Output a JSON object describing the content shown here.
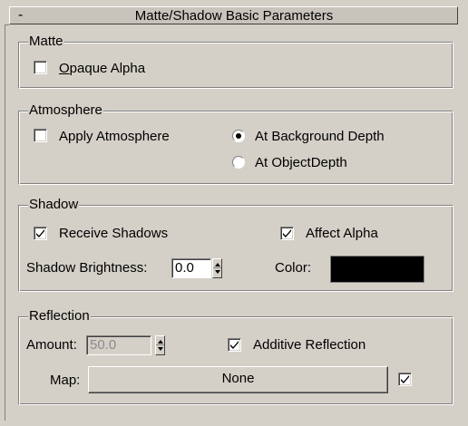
{
  "rollout": {
    "toggle": "-",
    "title": "Matte/Shadow Basic Parameters"
  },
  "matte": {
    "legend": "Matte",
    "opaque_alpha": {
      "label_underlined": "O",
      "label_rest": "paque Alpha",
      "checked": false
    }
  },
  "atmosphere": {
    "legend": "Atmosphere",
    "apply_atmosphere": {
      "label": "Apply Atmosphere",
      "checked": false
    },
    "depth_options": [
      {
        "label": "At Background Depth",
        "selected": true
      },
      {
        "label": "At ObjectDepth",
        "selected": false
      }
    ]
  },
  "shadow": {
    "legend": "Shadow",
    "receive_shadows": {
      "label": "Receive Shadows",
      "checked": true
    },
    "affect_alpha": {
      "label": "Affect Alpha",
      "checked": true
    },
    "brightness_label": "Shadow Brightness:",
    "brightness_value": "0.0",
    "color_label": "Color:",
    "color": "#000000"
  },
  "reflection": {
    "legend": "Reflection",
    "amount_label": "Amount:",
    "amount_value": "50.0",
    "additive": {
      "label": "Additive Reflection",
      "checked": true
    },
    "map_label": "Map:",
    "map_button": "None",
    "map_enabled": true
  },
  "colors": {
    "panel_bg": "#d4d0c8",
    "shadow_edge": "#808080",
    "highlight_edge": "#ffffff"
  }
}
